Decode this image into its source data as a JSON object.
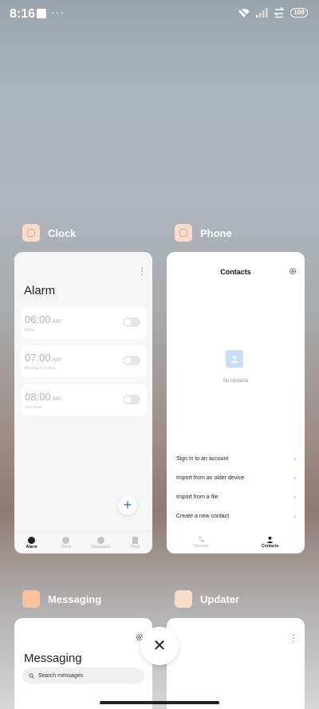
{
  "status_bar": {
    "time": "8:16",
    "dots": "···",
    "battery": "100"
  },
  "apps": {
    "clock": {
      "name": "Clock",
      "card_title": "Alarm",
      "alarms": [
        {
          "time": "06:00",
          "ampm": "AM",
          "label": "Once",
          "enabled": false
        },
        {
          "time": "07:00",
          "ampm": "AM",
          "label": "Monday to Friday",
          "enabled": false
        },
        {
          "time": "08:00",
          "ampm": "AM",
          "label": "Just once",
          "enabled": false
        }
      ],
      "fab_label": "+",
      "nav": [
        {
          "label": "Alarm",
          "active": true
        },
        {
          "label": "Clock",
          "active": false
        },
        {
          "label": "Stopwatch",
          "active": false
        },
        {
          "label": "Timer",
          "active": false
        }
      ]
    },
    "phone": {
      "name": "Phone",
      "card_title": "Contacts",
      "empty_text": "No contacts",
      "actions": [
        "Sign in to an account",
        "Import from an older device",
        "Import from a file",
        "Create a new contact"
      ],
      "nav": [
        {
          "label": "Recents",
          "active": false
        },
        {
          "label": "Contacts",
          "active": true
        }
      ]
    },
    "messaging": {
      "name": "Messaging",
      "card_title": "Messaging",
      "search_placeholder": "Search messages"
    },
    "updater": {
      "name": "Updater"
    }
  },
  "close_label": "✕",
  "colors": {
    "accent": "#2b7be4",
    "app_icon": "#f7dcca",
    "app_icon_messaging": "#f8c4a0"
  }
}
